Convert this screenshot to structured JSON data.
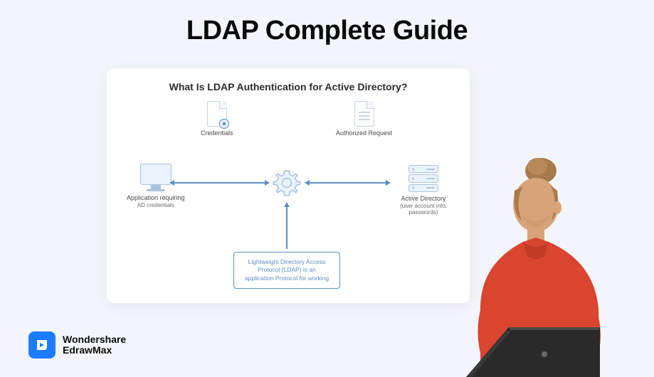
{
  "page": {
    "title": "LDAP Complete Guide"
  },
  "diagram": {
    "title": "What Is LDAP Authentication for Active Directory?",
    "nodes": {
      "credentials": {
        "label": "Credentials"
      },
      "authorized_request": {
        "label": "Authorized Request"
      },
      "application": {
        "label": "Application requiring",
        "sublabel": "AD credentials"
      },
      "active_directory": {
        "label": "Active Directory",
        "sublabel": "(user account info, passwords)"
      },
      "info": {
        "line1": "Lightweight Directory Access",
        "line2": "Protocol (LDAP) is an",
        "line3": "application Protocol for working"
      }
    }
  },
  "brand": {
    "line1": "Wondershare",
    "line2": "EdrawMax"
  }
}
